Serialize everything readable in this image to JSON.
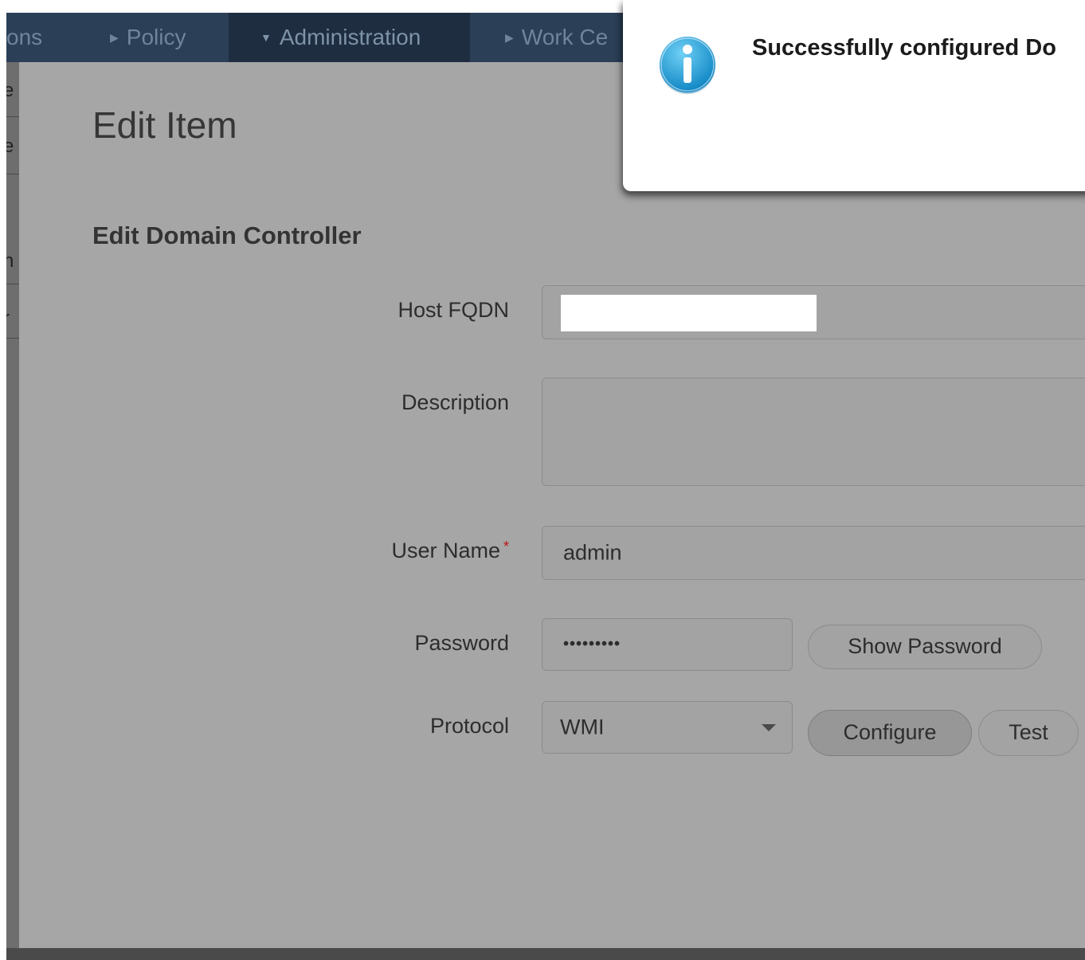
{
  "nav": {
    "items": [
      {
        "label": "ons",
        "caret": ""
      },
      {
        "label": "Policy",
        "caret": "▶"
      },
      {
        "label": "Administration",
        "caret": "▼"
      },
      {
        "label": "Work Ce",
        "caret": "▶"
      }
    ]
  },
  "left_fragments": [
    "e",
    "e",
    "n",
    "r"
  ],
  "modal": {
    "title": "Edit Item",
    "section": "Edit Domain Controller",
    "fields": {
      "host_fqdn": {
        "label": "Host FQDN",
        "value": ""
      },
      "description": {
        "label": "Description",
        "value": ""
      },
      "user_name": {
        "label": "User Name",
        "required_mark": "*",
        "value": "admin"
      },
      "password": {
        "label": "Password",
        "value": "•••••••••"
      },
      "protocol": {
        "label": "Protocol",
        "value": "WMI"
      }
    },
    "buttons": {
      "show_password": "Show Password",
      "configure": "Configure",
      "test": "Test"
    }
  },
  "toast": {
    "icon": "info-icon",
    "message": "Successfully configured Do"
  },
  "colors": {
    "nav_bg": "#2b3f57",
    "nav_active_bg": "#1e2d40",
    "modal_dim": "#a6a6a6",
    "info_blue": "#1d9ad6",
    "required": "#c01010"
  }
}
